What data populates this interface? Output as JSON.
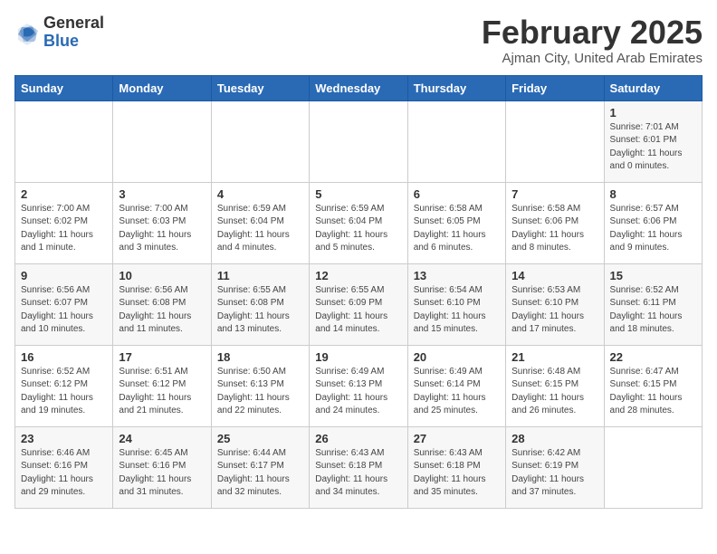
{
  "header": {
    "logo_general": "General",
    "logo_blue": "Blue",
    "title": "February 2025",
    "subtitle": "Ajman City, United Arab Emirates"
  },
  "weekdays": [
    "Sunday",
    "Monday",
    "Tuesday",
    "Wednesday",
    "Thursday",
    "Friday",
    "Saturday"
  ],
  "weeks": [
    [
      {
        "day": "",
        "info": ""
      },
      {
        "day": "",
        "info": ""
      },
      {
        "day": "",
        "info": ""
      },
      {
        "day": "",
        "info": ""
      },
      {
        "day": "",
        "info": ""
      },
      {
        "day": "",
        "info": ""
      },
      {
        "day": "1",
        "info": "Sunrise: 7:01 AM\nSunset: 6:01 PM\nDaylight: 11 hours\nand 0 minutes."
      }
    ],
    [
      {
        "day": "2",
        "info": "Sunrise: 7:00 AM\nSunset: 6:02 PM\nDaylight: 11 hours\nand 1 minute."
      },
      {
        "day": "3",
        "info": "Sunrise: 7:00 AM\nSunset: 6:03 PM\nDaylight: 11 hours\nand 3 minutes."
      },
      {
        "day": "4",
        "info": "Sunrise: 6:59 AM\nSunset: 6:04 PM\nDaylight: 11 hours\nand 4 minutes."
      },
      {
        "day": "5",
        "info": "Sunrise: 6:59 AM\nSunset: 6:04 PM\nDaylight: 11 hours\nand 5 minutes."
      },
      {
        "day": "6",
        "info": "Sunrise: 6:58 AM\nSunset: 6:05 PM\nDaylight: 11 hours\nand 6 minutes."
      },
      {
        "day": "7",
        "info": "Sunrise: 6:58 AM\nSunset: 6:06 PM\nDaylight: 11 hours\nand 8 minutes."
      },
      {
        "day": "8",
        "info": "Sunrise: 6:57 AM\nSunset: 6:06 PM\nDaylight: 11 hours\nand 9 minutes."
      }
    ],
    [
      {
        "day": "9",
        "info": "Sunrise: 6:56 AM\nSunset: 6:07 PM\nDaylight: 11 hours\nand 10 minutes."
      },
      {
        "day": "10",
        "info": "Sunrise: 6:56 AM\nSunset: 6:08 PM\nDaylight: 11 hours\nand 11 minutes."
      },
      {
        "day": "11",
        "info": "Sunrise: 6:55 AM\nSunset: 6:08 PM\nDaylight: 11 hours\nand 13 minutes."
      },
      {
        "day": "12",
        "info": "Sunrise: 6:55 AM\nSunset: 6:09 PM\nDaylight: 11 hours\nand 14 minutes."
      },
      {
        "day": "13",
        "info": "Sunrise: 6:54 AM\nSunset: 6:10 PM\nDaylight: 11 hours\nand 15 minutes."
      },
      {
        "day": "14",
        "info": "Sunrise: 6:53 AM\nSunset: 6:10 PM\nDaylight: 11 hours\nand 17 minutes."
      },
      {
        "day": "15",
        "info": "Sunrise: 6:52 AM\nSunset: 6:11 PM\nDaylight: 11 hours\nand 18 minutes."
      }
    ],
    [
      {
        "day": "16",
        "info": "Sunrise: 6:52 AM\nSunset: 6:12 PM\nDaylight: 11 hours\nand 19 minutes."
      },
      {
        "day": "17",
        "info": "Sunrise: 6:51 AM\nSunset: 6:12 PM\nDaylight: 11 hours\nand 21 minutes."
      },
      {
        "day": "18",
        "info": "Sunrise: 6:50 AM\nSunset: 6:13 PM\nDaylight: 11 hours\nand 22 minutes."
      },
      {
        "day": "19",
        "info": "Sunrise: 6:49 AM\nSunset: 6:13 PM\nDaylight: 11 hours\nand 24 minutes."
      },
      {
        "day": "20",
        "info": "Sunrise: 6:49 AM\nSunset: 6:14 PM\nDaylight: 11 hours\nand 25 minutes."
      },
      {
        "day": "21",
        "info": "Sunrise: 6:48 AM\nSunset: 6:15 PM\nDaylight: 11 hours\nand 26 minutes."
      },
      {
        "day": "22",
        "info": "Sunrise: 6:47 AM\nSunset: 6:15 PM\nDaylight: 11 hours\nand 28 minutes."
      }
    ],
    [
      {
        "day": "23",
        "info": "Sunrise: 6:46 AM\nSunset: 6:16 PM\nDaylight: 11 hours\nand 29 minutes."
      },
      {
        "day": "24",
        "info": "Sunrise: 6:45 AM\nSunset: 6:16 PM\nDaylight: 11 hours\nand 31 minutes."
      },
      {
        "day": "25",
        "info": "Sunrise: 6:44 AM\nSunset: 6:17 PM\nDaylight: 11 hours\nand 32 minutes."
      },
      {
        "day": "26",
        "info": "Sunrise: 6:43 AM\nSunset: 6:18 PM\nDaylight: 11 hours\nand 34 minutes."
      },
      {
        "day": "27",
        "info": "Sunrise: 6:43 AM\nSunset: 6:18 PM\nDaylight: 11 hours\nand 35 minutes."
      },
      {
        "day": "28",
        "info": "Sunrise: 6:42 AM\nSunset: 6:19 PM\nDaylight: 11 hours\nand 37 minutes."
      },
      {
        "day": "",
        "info": ""
      }
    ]
  ]
}
